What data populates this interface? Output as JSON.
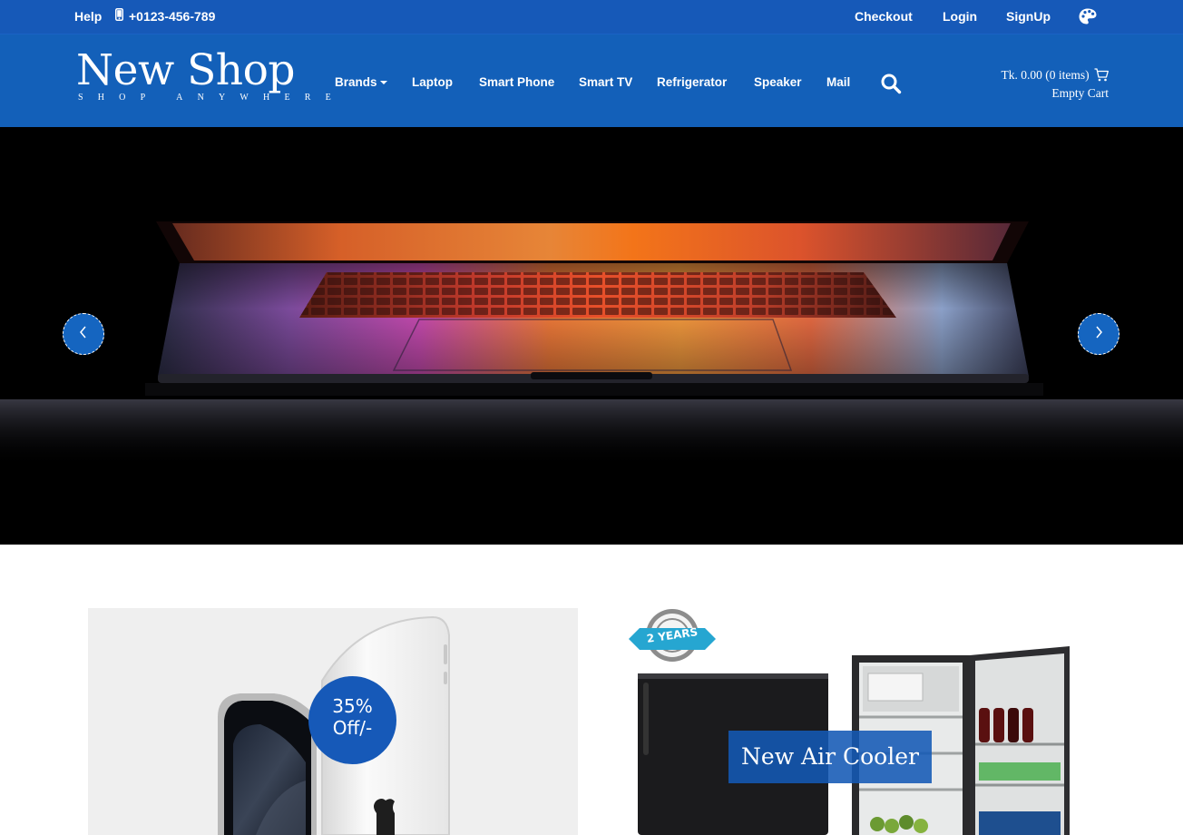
{
  "topbar": {
    "help_label": "Help",
    "phone": "+0123-456-789",
    "checkout_label": "Checkout",
    "login_label": "Login",
    "signup_label": "SignUp"
  },
  "header": {
    "logo_title": "New Shop",
    "logo_tagline": "SHOP ANYWHERE",
    "nav": {
      "brands": "Brands",
      "laptop": "Laptop",
      "smart_phone": "Smart Phone",
      "smart_tv": "Smart TV",
      "refrigerator": "Refrigerator",
      "speaker": "Speaker",
      "mail": "Mail"
    },
    "cart": {
      "total_text": "Tk. 0.00 (0 items)",
      "status_text": "Empty Cart"
    }
  },
  "hero": {
    "slide_image": "laptop-lid-opening-photo",
    "prev_icon": "chevron-left-icon",
    "next_icon": "chevron-right-icon"
  },
  "promos": {
    "phone": {
      "image": "iphone-promo-photo",
      "badge_line1": "35%",
      "badge_line2": "Off/-"
    },
    "fridge": {
      "image": "refrigerator-promo-photo",
      "warranty_badge": "2 YEARS",
      "caption": "New Air Cooler"
    }
  },
  "colors": {
    "brand_blue": "#1360b9",
    "topbar_blue": "#1659b8",
    "hero_background": "#000000"
  }
}
